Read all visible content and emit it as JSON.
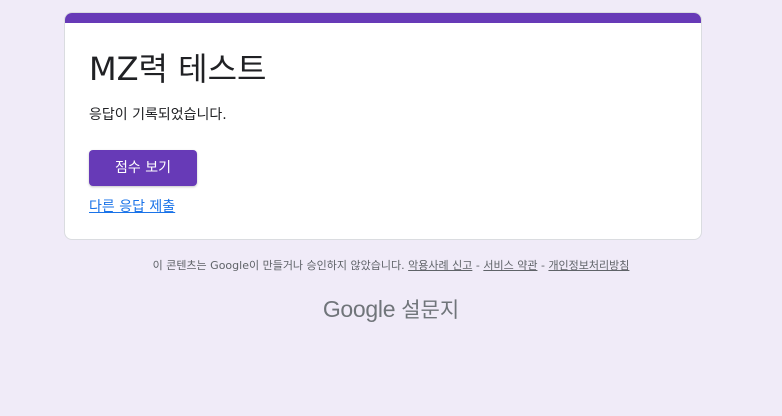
{
  "form": {
    "title": "MZ력 테스트",
    "confirmation": "응답이 기록되었습니다.",
    "view_score_label": "점수 보기",
    "resubmit_label": "다른 응답 제출"
  },
  "footer": {
    "disclaimer": "이 콘텐츠는 Google이 만들거나 승인하지 않았습니다.",
    "report_abuse": "악용사례 신고",
    "separator": "-",
    "terms": "서비스 약관",
    "privacy": "개인정보처리방침"
  },
  "brand": {
    "google": "Google",
    "product": "설문지"
  },
  "colors": {
    "accent": "#673ab7",
    "background": "#f0ebf8",
    "link": "#1a73e8"
  }
}
